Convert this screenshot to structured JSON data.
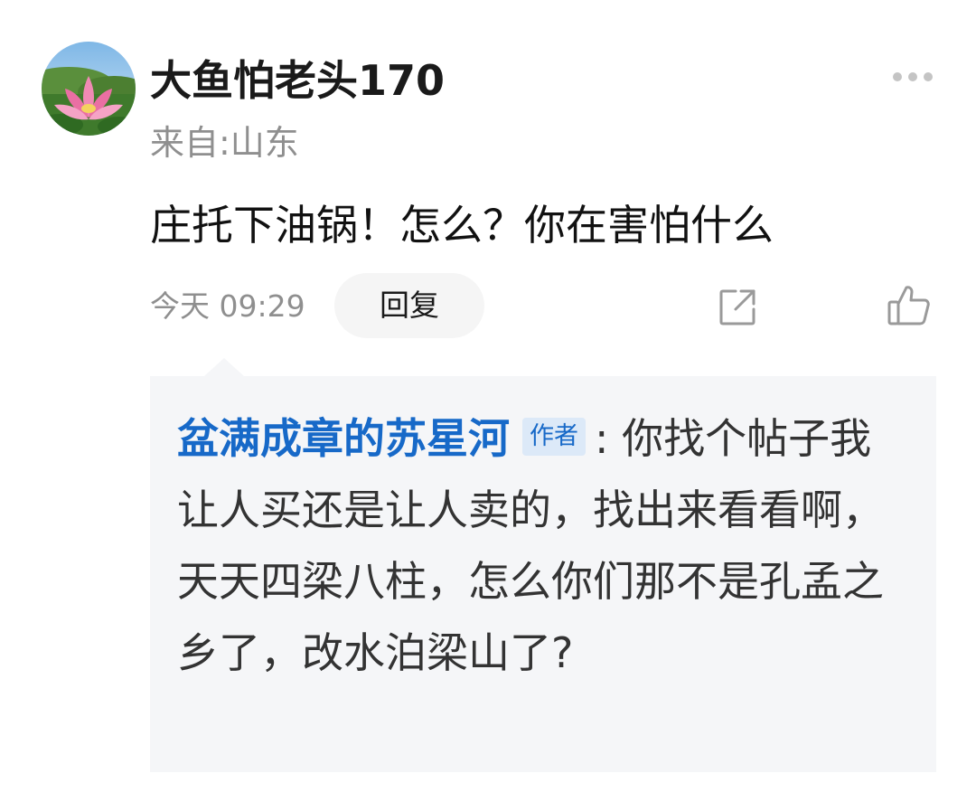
{
  "comment": {
    "avatar_icon": "lotus-avatar-icon",
    "username": "大鱼怕老头170",
    "location": "来自:山东",
    "text": "庄托下油锅！怎么？你在害怕什么",
    "timestamp": "今天 09:29",
    "reply_label": "回复",
    "share_icon": "share-icon",
    "like_icon": "thumbs-up-icon",
    "more_icon": "more-dots-icon"
  },
  "quoted_reply": {
    "author": "盆满成章的苏星河",
    "author_badge": "作者",
    "text": ": 你找个帖子我让人买还是让人卖的，找出来看看啊，天天四梁八柱，怎么你们那不是孔孟之乡了，改水泊梁山了?"
  },
  "colors": {
    "author_link": "#1769c8",
    "muted_text": "#8f8f8f",
    "reply_background": "#f5f6f8"
  }
}
